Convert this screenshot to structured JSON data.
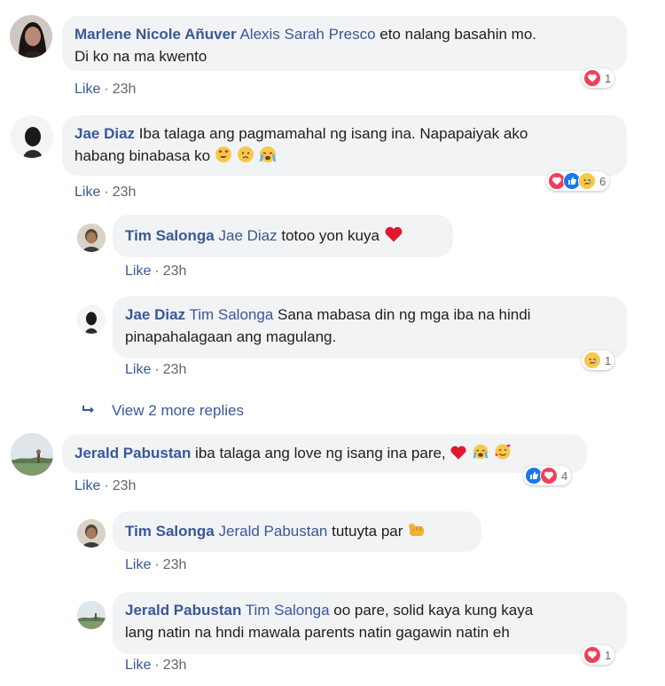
{
  "comments": [
    {
      "author": "Marlene Nicole Añuver",
      "mention": "Alexis Sarah Presco",
      "text_line1": " eto nalang basahin mo.",
      "text_line2": "Di ko na ma kwento",
      "like": "Like",
      "time": "23h",
      "reaction_count": "1"
    },
    {
      "author": "Jae Diaz",
      "text_line1": " Iba talaga ang pagmamahal ng isang ina. Napapaiyak ako",
      "text_line2": "habang binabasa ko",
      "like": "Like",
      "time": "23h",
      "reaction_count": "6"
    },
    {
      "author": "Tim Salonga",
      "mention": "Jae Diaz",
      "text_line1": " totoo yon kuya",
      "like": "Like",
      "time": "23h"
    },
    {
      "author": "Jae Diaz",
      "mention": "Tim Salonga",
      "text_line1": " Sana mabasa din ng mga iba na hindi",
      "text_line2": "pinapahalagaan ang magulang.",
      "like": "Like",
      "time": "23h",
      "reaction_count": "1"
    },
    {
      "author": "Jerald Pabustan",
      "text_line1": " iba talaga ang love ng isang ina pare,",
      "like": "Like",
      "time": "23h",
      "reaction_count": "4"
    },
    {
      "author": "Tim Salonga",
      "mention": "Jerald Pabustan",
      "text_line1": " tutuyta par",
      "like": "Like",
      "time": "23h"
    },
    {
      "author": "Jerald Pabustan",
      "mention": "Tim Salonga",
      "text_line1": " oo pare, solid kaya kung kaya",
      "text_line2": "lang natin na hndi mawala parents natin gagawin natin eh",
      "like": "Like",
      "time": "23h",
      "reaction_count": "1"
    }
  ],
  "view_more": "View 2 more replies",
  "dot": "·",
  "colors": {
    "name_blue": "#385898",
    "bubble_bg": "#f2f3f5",
    "meta_gray": "#606770",
    "love_red": "#f33e58",
    "like_blue": "#1877f2"
  }
}
